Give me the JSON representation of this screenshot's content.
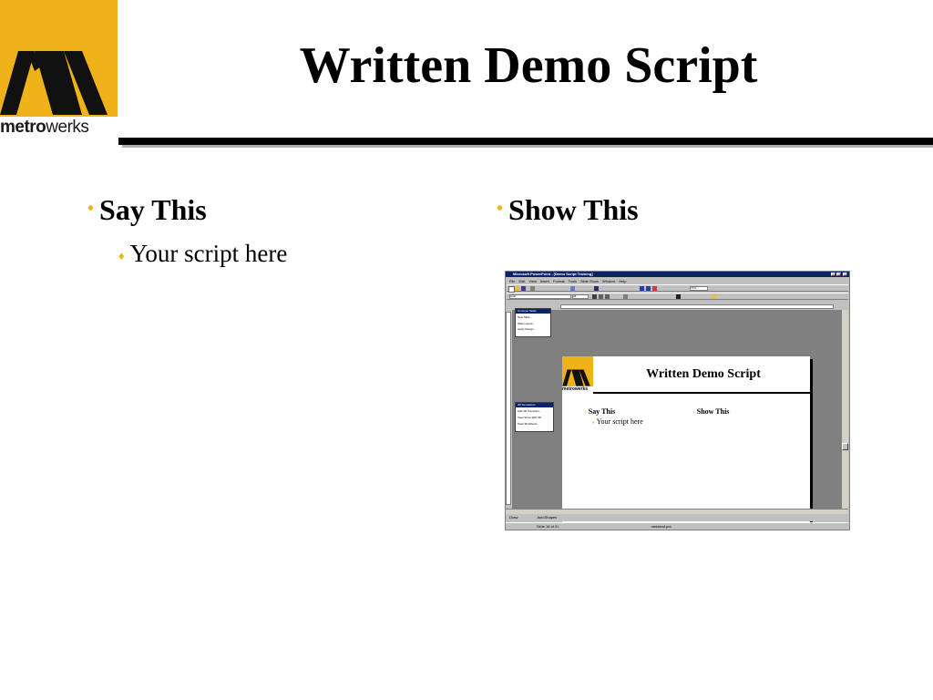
{
  "logo": {
    "text_bold": "metro",
    "text_light": "werks"
  },
  "slide": {
    "title": "Written Demo Script"
  },
  "left": {
    "heading": "Say This",
    "items": [
      "Your script here"
    ]
  },
  "right": {
    "heading": "Show This"
  },
  "screenshot": {
    "window_title": "Microsoft PowerPoint - [Demo Script Training]",
    "menu": [
      "File",
      "Edit",
      "View",
      "Insert",
      "Format",
      "Tools",
      "Slide Show",
      "Window",
      "Help"
    ],
    "zoom": "77%",
    "font_name": "Arial",
    "font_size": "28",
    "task_pane_1": {
      "title": "Common Tasks",
      "items": [
        "New Slide...",
        "Slide Layout...",
        "Apply Design..."
      ]
    },
    "task_pane_2": {
      "title": "3D Sensations",
      "items": [
        "Add 3D Transition...",
        "View Show With 3D",
        "Pack 3D Effects..."
      ]
    },
    "mini_slide": {
      "title": "Written Demo Script",
      "left_heading": "Say This",
      "left_item": "Your script here",
      "right_heading": "Show This",
      "logo_text": "metrowerks"
    },
    "draw_label": "Draw",
    "autoshapes_label": "AutoShapes",
    "status_slide": "Slide 16 of 21",
    "status_design": "metatest.pot"
  },
  "colors": {
    "brand_yellow": "#f0b21b",
    "title_bar": "#0a246a"
  }
}
